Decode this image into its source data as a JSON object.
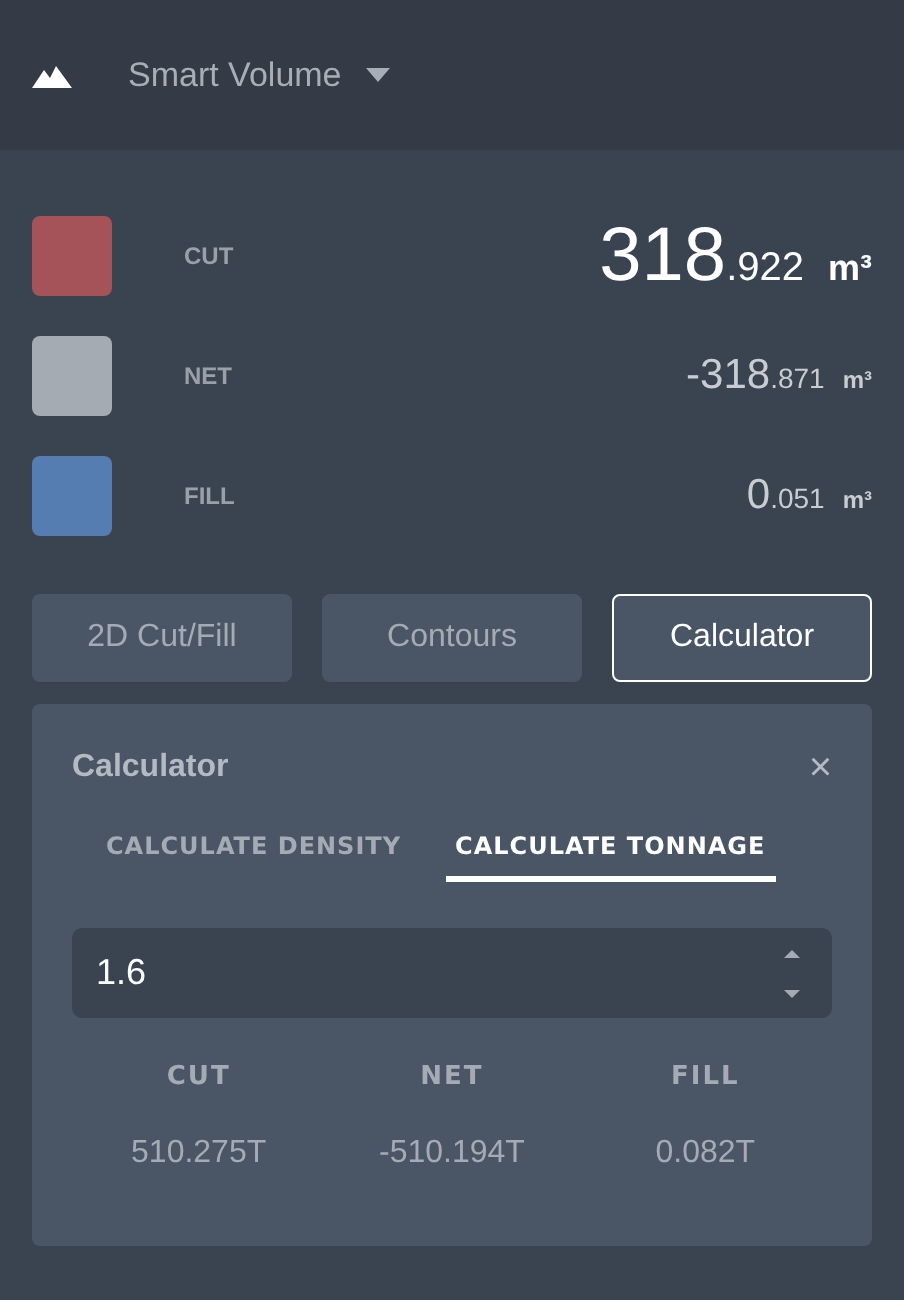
{
  "header": {
    "title": "Smart Volume"
  },
  "volumes": [
    {
      "label": "CUT",
      "color": "#a55358",
      "integer": "318",
      "decimal": ".922",
      "unit": "m³",
      "emphasized": true
    },
    {
      "label": "NET",
      "color": "#a5abb3",
      "integer": "-318",
      "decimal": ".871",
      "unit": "m³",
      "emphasized": false
    },
    {
      "label": "FILL",
      "color": "#567db2",
      "integer": "0",
      "decimal": ".051",
      "unit": "m³",
      "emphasized": false
    }
  ],
  "tabs": [
    {
      "label": "2D Cut/Fill",
      "selected": false
    },
    {
      "label": "Contours",
      "selected": false
    },
    {
      "label": "Calculator",
      "selected": true
    }
  ],
  "panel": {
    "title": "Calculator",
    "close": "×",
    "subtabs": [
      {
        "label": "CALCULATE DENSITY",
        "selected": false
      },
      {
        "label": "CALCULATE TONNAGE",
        "selected": true
      }
    ],
    "density": {
      "value": "1.6"
    },
    "results": [
      {
        "label": "CUT",
        "value": "510.275T"
      },
      {
        "label": "NET",
        "value": "-510.194T"
      },
      {
        "label": "FILL",
        "value": "0.082T"
      }
    ]
  }
}
